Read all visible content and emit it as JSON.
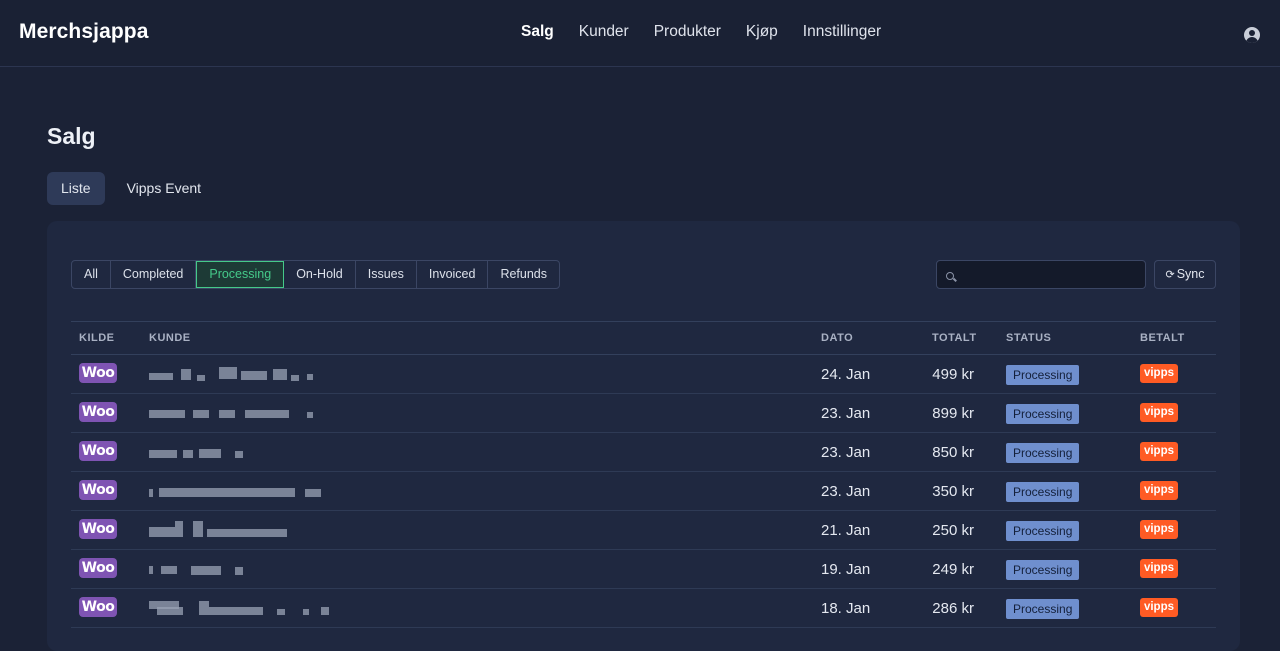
{
  "app": {
    "title": "Merchsjappa"
  },
  "nav": {
    "items": [
      "Salg",
      "Kunder",
      "Produkter",
      "Kjøp",
      "Innstillinger"
    ],
    "active": "Salg"
  },
  "page": {
    "title": "Salg"
  },
  "subtabs": [
    "Liste",
    "Vipps Event"
  ],
  "filters": [
    "All",
    "Completed",
    "Processing",
    "On-Hold",
    "Issues",
    "Invoiced",
    "Refunds"
  ],
  "active_filter": "Processing",
  "search": {
    "placeholder": "",
    "value": ""
  },
  "sync_label": "Sync",
  "table": {
    "headers": [
      "KILDE",
      "KUNDE",
      "DATO",
      "TOTALT",
      "STATUS",
      "BETALT"
    ],
    "rows": [
      {
        "source": "Woo",
        "customer": "",
        "date": "24. Jan",
        "total": "499 kr",
        "status": "Processing",
        "paid": "vipps"
      },
      {
        "source": "Woo",
        "customer": "",
        "date": "23. Jan",
        "total": "899 kr",
        "status": "Processing",
        "paid": "vipps"
      },
      {
        "source": "Woo",
        "customer": "",
        "date": "23. Jan",
        "total": "850 kr",
        "status": "Processing",
        "paid": "vipps"
      },
      {
        "source": "Woo",
        "customer": "",
        "date": "23. Jan",
        "total": "350 kr",
        "status": "Processing",
        "paid": "vipps"
      },
      {
        "source": "Woo",
        "customer": "",
        "date": "21. Jan",
        "total": "250 kr",
        "status": "Processing",
        "paid": "vipps"
      },
      {
        "source": "Woo",
        "customer": "",
        "date": "19. Jan",
        "total": "249 kr",
        "status": "Processing",
        "paid": "vipps"
      },
      {
        "source": "Woo",
        "customer": "",
        "date": "18. Jan",
        "total": "286 kr",
        "status": "Processing",
        "paid": "vipps"
      }
    ]
  },
  "colors": {
    "background": "#1b2236",
    "card": "#1f2840",
    "accent_green": "#45c98a",
    "woo_purple": "#7f54b3",
    "vipps_orange": "#ff5b24",
    "status_badge": "#6f8fce"
  },
  "icons": {
    "user": "user-circle-icon",
    "search": "search-icon",
    "sync": "sync-icon"
  }
}
